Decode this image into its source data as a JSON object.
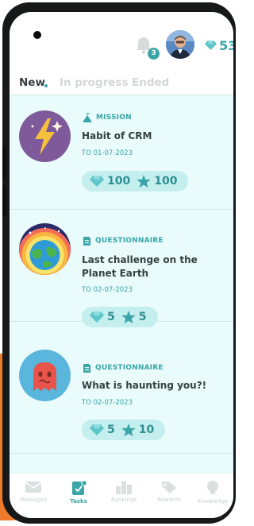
{
  "header": {
    "notification_count": "3",
    "gem_count": "53"
  },
  "tabs": [
    {
      "label": "New",
      "active": true
    },
    {
      "label": "In progress",
      "active": false
    },
    {
      "label": "Ended",
      "active": false
    }
  ],
  "tasks": [
    {
      "type": "MISSION",
      "title": "Habit of CRM",
      "date": "TO 01-07-2023",
      "gems": "100",
      "stars": "100",
      "icon": "lightning-icon"
    },
    {
      "type": "QUESTIONNAIRE",
      "title": "Last challenge on the Planet Earth",
      "date": "TO 02-07-2023",
      "gems": "5",
      "stars": "5",
      "icon": "planet-earth-icon"
    },
    {
      "type": "QUESTIONNAIRE",
      "title": "What is haunting you?!",
      "date": "TO 02-07-2023",
      "gems": "5",
      "stars": "10",
      "icon": "ghost-icon"
    }
  ],
  "bottom_nav": [
    {
      "label": "Messages",
      "icon": "envelope-icon",
      "active": false
    },
    {
      "label": "Tasks",
      "icon": "clipboard-check-icon",
      "active": true
    },
    {
      "label": "Rankings",
      "icon": "podium-icon",
      "active": false
    },
    {
      "label": "Rewards",
      "icon": "tag-icon",
      "active": false
    },
    {
      "label": "Knowledge",
      "icon": "lightbulb-icon",
      "active": false
    }
  ],
  "colors": {
    "accent": "#3aa5a7",
    "screen_bg": "#e9fbfb",
    "pill_bg": "#c5efef",
    "text_dark": "#364043",
    "orange": "#ee7a2b"
  }
}
